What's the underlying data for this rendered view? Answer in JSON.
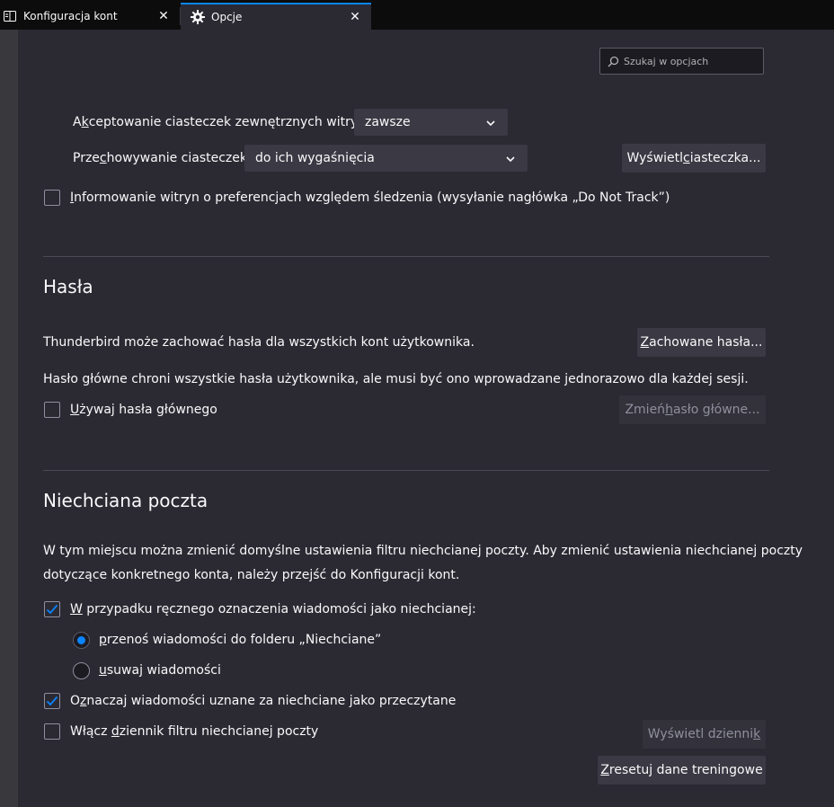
{
  "tabs": [
    {
      "label": "Konfiguracja kont",
      "icon": "accounts-icon"
    },
    {
      "label": "Opcje",
      "icon": "gear-icon"
    }
  ],
  "search": {
    "placeholder": "Szukaj w opcjach"
  },
  "cookies": {
    "accept_third_party": {
      "label_pre": "A",
      "label_u": "k",
      "label_post": "ceptowanie ciasteczek zewnętrznych witryn:",
      "value": "zawsze"
    },
    "keep": {
      "label_pre": "Prze",
      "label_u": "c",
      "label_post": "howywanie ciasteczek:",
      "value": "do ich wygaśnięcia"
    },
    "show_button": {
      "pre": "Wyświetl ",
      "u": "c",
      "post": "iasteczka..."
    },
    "dnt": {
      "u": "I",
      "post": "nformowanie witryn o preferencjach względem śledzenia (wysyłanie nagłówka „Do Not Track”)",
      "checked": false
    }
  },
  "passwords": {
    "heading": "Hasła",
    "description": "Thunderbird może zachować hasła dla wszystkich kont użytkownika.",
    "saved_button": {
      "u": "Z",
      "post": "achowane hasła..."
    },
    "master_description": "Hasło główne chroni wszystkie hasła użytkownika, ale musi być ono wprowadzane jednorazowo dla każdej sesji.",
    "use_master": {
      "u": "U",
      "post": "żywaj hasła głównego",
      "checked": false
    },
    "change_master_button": {
      "pre": "Zmień ",
      "u": "h",
      "post": "asło główne..."
    }
  },
  "junk": {
    "heading": "Niechciana poczta",
    "description_line1": "W tym miejscu można zmienić domyślne ustawienia filtru niechcianej poczty. Aby zmienić ustawienia niechcianej poczty",
    "description_line2": "dotyczące konkretnego konta, należy przejść do Konfiguracji kont.",
    "manual_mark": {
      "u": "W",
      "post": " przypadku ręcznego oznaczenia wiadomości jako niechcianej:",
      "checked": true
    },
    "move_option": {
      "u": "p",
      "post": "rzenoś wiadomości do folderu „Niechciane”",
      "selected": true
    },
    "delete_option": {
      "u": "u",
      "post": "suwaj wiadomości",
      "selected": false
    },
    "mark_read": {
      "pre": "O",
      "u": "z",
      "post": "naczaj wiadomości uznane za niechciane jako przeczytane",
      "checked": true
    },
    "enable_log": {
      "pre": "Włącz ",
      "u": "d",
      "post": "ziennik filtru niechcianej poczty",
      "checked": false
    },
    "show_log_button": {
      "pre": "Wyświetl dzienni",
      "u": "k",
      "post": ""
    },
    "reset_button": {
      "u": "Z",
      "post": "resetuj dane treningowe"
    }
  },
  "colors": {
    "accent": "#0a84ff",
    "background": "#2b2a33"
  }
}
